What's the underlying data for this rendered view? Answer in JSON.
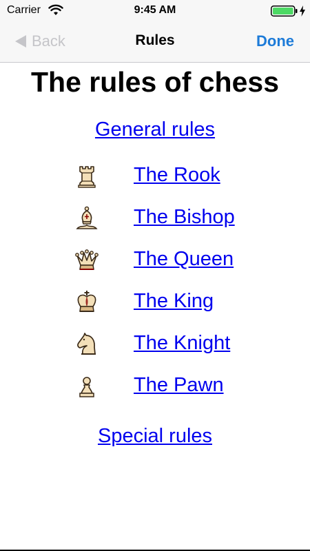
{
  "status_bar": {
    "carrier": "Carrier",
    "time": "9:45 AM",
    "battery_color": "#4cd964"
  },
  "nav": {
    "back_label": "Back",
    "title": "Rules",
    "done_label": "Done",
    "done_color": "#1d7bd8"
  },
  "page": {
    "title": "The rules of chess",
    "general_link": "General rules",
    "special_link": "Special rules",
    "link_color": "#0000ee",
    "pieces": [
      {
        "label": "The Rook",
        "icon": "rook-icon"
      },
      {
        "label": "The Bishop",
        "icon": "bishop-icon"
      },
      {
        "label": "The Queen",
        "icon": "queen-icon"
      },
      {
        "label": "The King",
        "icon": "king-icon"
      },
      {
        "label": "The Knight",
        "icon": "knight-icon"
      },
      {
        "label": "The Pawn",
        "icon": "pawn-icon"
      }
    ]
  }
}
